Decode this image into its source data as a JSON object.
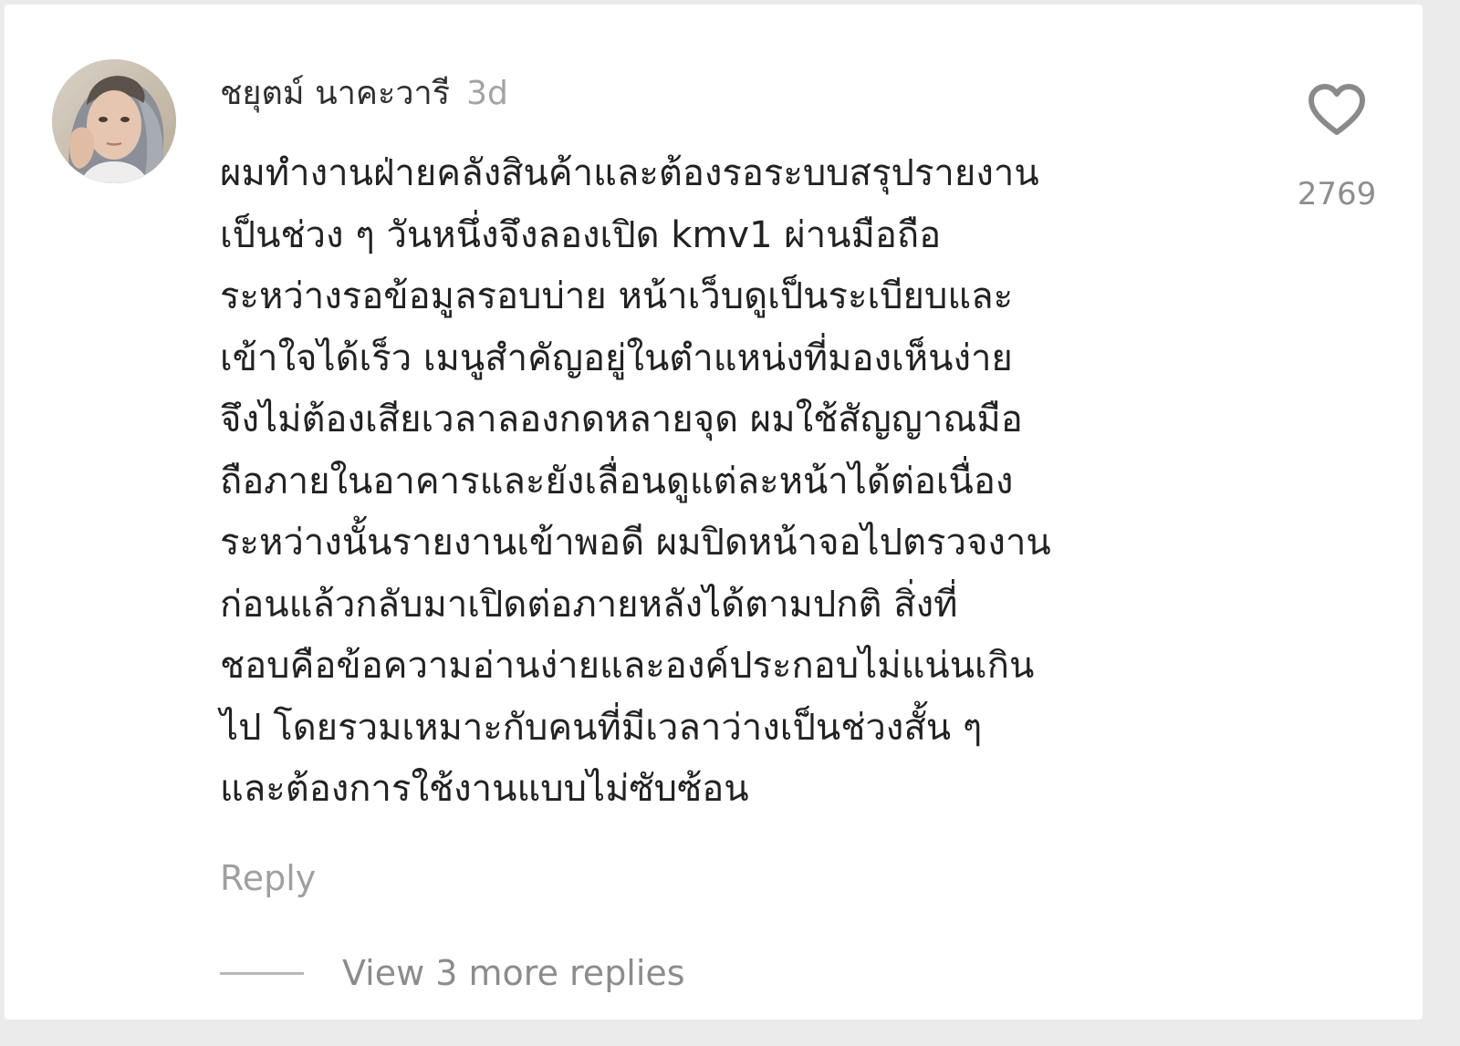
{
  "comment": {
    "username": "ชยุตม์ นาคะวารี",
    "timestamp": "3d",
    "lines": [
      "ผมทำงานฝ่ายคลังสินค้าและต้องรอระบบสรุปรายงาน",
      "เป็นช่วง ๆ วันหนึ่งจึงลองเปิด kmv1 ผ่านมือถือ",
      "ระหว่างรอข้อมูลรอบบ่าย หน้าเว็บดูเป็นระเบียบและ",
      "เข้าใจได้เร็ว เมนูสำคัญอยู่ในตำแหน่งที่มองเห็นง่าย",
      "จึงไม่ต้องเสียเวลาลองกดหลายจุด ผมใช้สัญญาณมือ",
      "ถือภายในอาคารและยังเลื่อนดูแต่ละหน้าได้ต่อเนื่อง",
      "ระหว่างนั้นรายงานเข้าพอดี ผมปิดหน้าจอไปตรวจงาน",
      "ก่อนแล้วกลับมาเปิดต่อภายหลังได้ตามปกติ สิ่งที่",
      "ชอบคือข้อความอ่านง่ายและองค์ประกอบไม่แน่นเกิน",
      "ไป โดยรวมเหมาะกับคนที่มีเวลาว่างเป็นช่วงสั้น ๆ",
      "และต้องการใช้งานแบบไม่ซับซ้อน"
    ],
    "like_count": "2769",
    "like_icon": "heart-outline-icon",
    "reply_label": "Reply",
    "view_replies_label": "View 3 more replies"
  },
  "colors": {
    "username": "#2f2f2f",
    "timestamp": "#a3a3a3",
    "body_text": "#222222",
    "muted": "#8e8e8e",
    "background": "#ffffff"
  }
}
